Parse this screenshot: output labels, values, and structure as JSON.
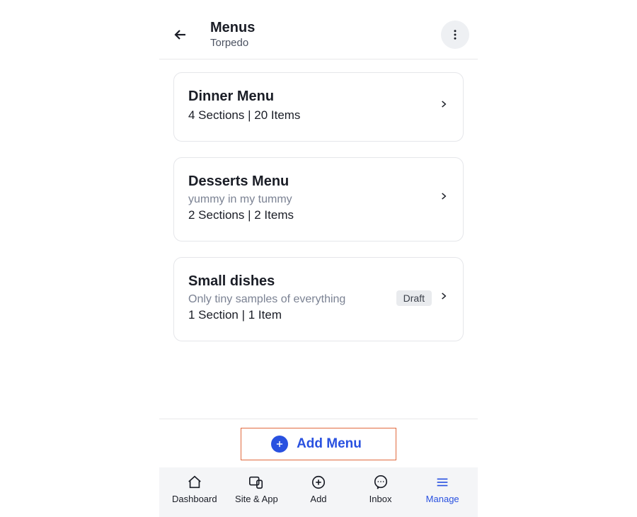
{
  "header": {
    "title": "Menus",
    "subtitle": "Torpedo"
  },
  "menus": [
    {
      "title": "Dinner Menu",
      "description": "",
      "meta": "4 Sections | 20 Items",
      "badge": ""
    },
    {
      "title": "Desserts Menu",
      "description": "yummy in my tummy",
      "meta": "2 Sections | 2 Items",
      "badge": ""
    },
    {
      "title": "Small dishes",
      "description": "Only tiny samples of everything",
      "meta": "1 Section | 1 Item",
      "badge": "Draft"
    }
  ],
  "add_button": {
    "label": "Add Menu"
  },
  "nav": {
    "items": [
      {
        "label": "Dashboard"
      },
      {
        "label": "Site & App"
      },
      {
        "label": "Add"
      },
      {
        "label": "Inbox"
      },
      {
        "label": "Manage"
      }
    ]
  }
}
